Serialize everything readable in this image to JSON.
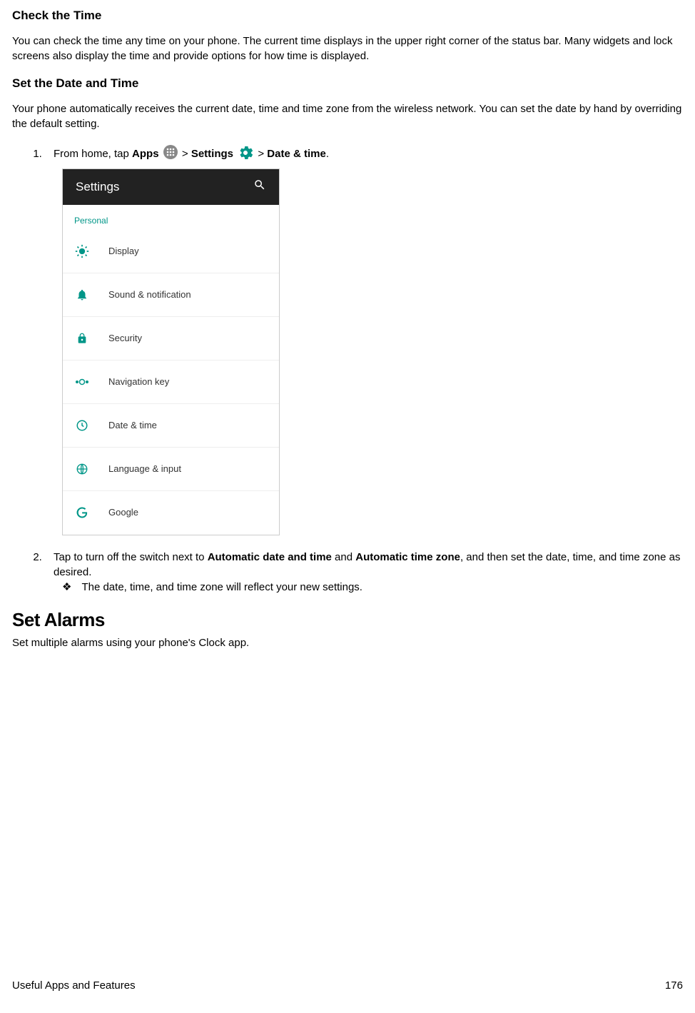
{
  "section1": {
    "heading": "Check the Time",
    "body": "You can check the time any time on your phone. The current time displays in the upper right corner of the status bar. Many widgets and lock screens also display the time and provide options for how time is displayed."
  },
  "section2": {
    "heading": "Set the Date and Time",
    "body": "Your phone automatically receives the current date, time and time zone from the wireless network. You can set the date by hand by overriding the default setting."
  },
  "step1": {
    "prefix": "From home, tap ",
    "apps": "Apps",
    "gt1": " > ",
    "settings": "Settings",
    "gt2": " > ",
    "datetime": "Date & time",
    "period": "."
  },
  "screenshot": {
    "title": "Settings",
    "section": "Personal",
    "items": [
      "Display",
      "Sound & notification",
      "Security",
      "Navigation key",
      "Date & time",
      "Language & input",
      "Google"
    ]
  },
  "step2": {
    "prefix": "Tap to turn off the switch next to ",
    "bold1": "Automatic date and time",
    "mid": " and ",
    "bold2": "Automatic time zone",
    "suffix": ", and then set the date, time, and time zone as desired."
  },
  "result": {
    "marker": "❖",
    "text": "The date, time, and time zone will reflect your new settings."
  },
  "section3": {
    "heading": "Set Alarms",
    "body": "Set multiple alarms using your phone's Clock app."
  },
  "footer": {
    "left": "Useful Apps and Features",
    "right": "176"
  }
}
